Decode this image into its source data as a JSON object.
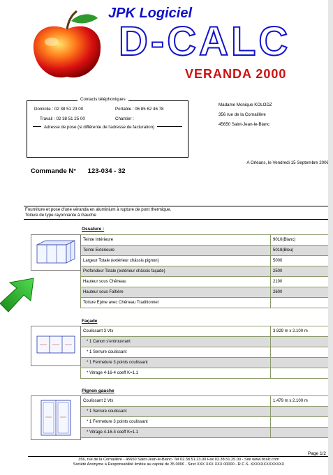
{
  "header": {
    "brand_top": "JPK Logiciel",
    "brand_main": "D-CALC",
    "brand_sub": "VERANDA 2000"
  },
  "contacts": {
    "legend": "Contacts téléphoniques",
    "domicile": "Domicile :  02 38 51 23 00",
    "portable": "Portable :  06 85 62 46 78",
    "travail": "Travail :  02 38 51 25 00",
    "chantier": "Chantier :",
    "adresse_pose": "Adresse de pose (si différente de l'adresse de facturation)"
  },
  "client": {
    "name": "Madame Monique KOLODZ",
    "street": "356 rue de la Cornaillère",
    "city": "45650 Saint-Jean-le-Blanc"
  },
  "date_line": "A Orléans, le Vendredi 15 Septembre 2006",
  "commande": {
    "label": "Commande N°",
    "number": "123-034 - 32"
  },
  "intro": {
    "line1": "Fourniture et pose d'une véranda en aluminium à rupture de pont thermique.",
    "line2": "Toiture de type rayonnante à Gauche"
  },
  "ossature": {
    "title": "Ossature :",
    "rows": [
      [
        "Teinte Intérieure",
        "9010(Blanc)"
      ],
      [
        "Teinte Extérieure",
        "5018(Bleu)"
      ],
      [
        "Largeur Totale (extérieur châssis pignon)",
        "5000"
      ],
      [
        "Profondeur Totale (extérieur châssis façade)",
        "2500"
      ],
      [
        "Hauteur sous Chêneau",
        "2100"
      ],
      [
        "Hauteur sous Faîtière",
        "2600"
      ],
      [
        "Toiture Epine avec Chêneau Traditionnel",
        ""
      ]
    ]
  },
  "facade": {
    "title": "Façade",
    "rows": [
      [
        "Coulissant 3 Vtx",
        "3.929 m x 2.100 m"
      ],
      [
        "* 1 Canon s'entrouvrant",
        ""
      ],
      [
        "* 1 Serrure coulissant",
        ""
      ],
      [
        "* 1 Fermeture 3 points coulissant",
        ""
      ],
      [
        "* Vitrage 4-16-4 coeff K=1.1",
        ""
      ]
    ]
  },
  "pignon": {
    "title": "Pignon gauche",
    "rows": [
      [
        "Coulissant 2 Vtx",
        "1.479 m x 2.100 m"
      ],
      [
        "* 1 Serrure coulissant",
        ""
      ],
      [
        "* 1 Fermeture 3 points coulissant",
        ""
      ],
      [
        "* Vitrage 4-16-4 coeff K=1.1",
        ""
      ]
    ]
  },
  "page": "Page 1/2",
  "footer": {
    "line1": "356, rue de la Cornaillère - 45650 Saint-Jean-le-Blanc-  Tel  02.38.51.23.00   Fax  02.38.51.25.00  -  Site www.dcalc.com",
    "line2": "Société Anonyme à Responsabilité limitée au capital de 35 000€ - Siret XXX XXX XXX 00000 - R.C.S. XXXXXXXXXXXXX"
  },
  "colors": {
    "brand_blue": "#1111cc",
    "brand_red": "#cc1111",
    "arrow_green": "#22bb22",
    "table_border": "#8b9a6a"
  },
  "icons": [
    "apple-logo-icon",
    "green-arrow-icon"
  ]
}
